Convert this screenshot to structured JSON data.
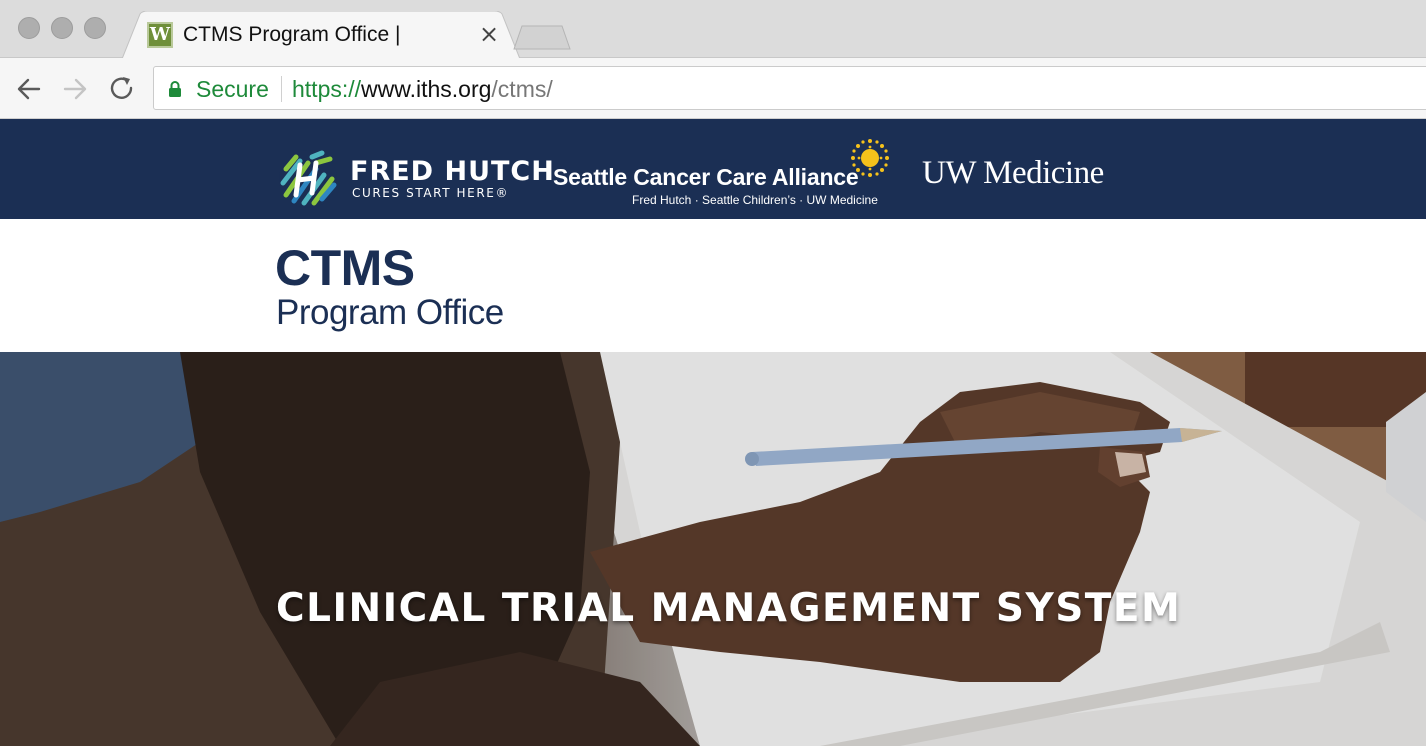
{
  "browser": {
    "tab": {
      "title": "CTMS Program Office |",
      "favicon_letter": "W",
      "close_glyph": "×"
    },
    "address_bar": {
      "secure_label": "Secure",
      "url_scheme": "https://",
      "url_host": "www.iths.org",
      "url_path": "/ctms/"
    },
    "accent_secure": "#1e8a3a"
  },
  "partners": {
    "fred_hutch": {
      "name": "FRED HUTCH",
      "tagline": "CURES START HERE®"
    },
    "scca": {
      "name": "Seattle Cancer Care Alliance",
      "subtitle": "Fred Hutch · Seattle Children’s · UW Medicine"
    },
    "uw_medicine": {
      "name": "UW Medicine"
    },
    "bar_color": "#1b2f54"
  },
  "site": {
    "title": "CTMS",
    "subtitle": "Program Office",
    "brand_color": "#1b2f54"
  },
  "hero": {
    "headline": "CLINICAL TRIAL MANAGEMENT SYSTEM"
  }
}
